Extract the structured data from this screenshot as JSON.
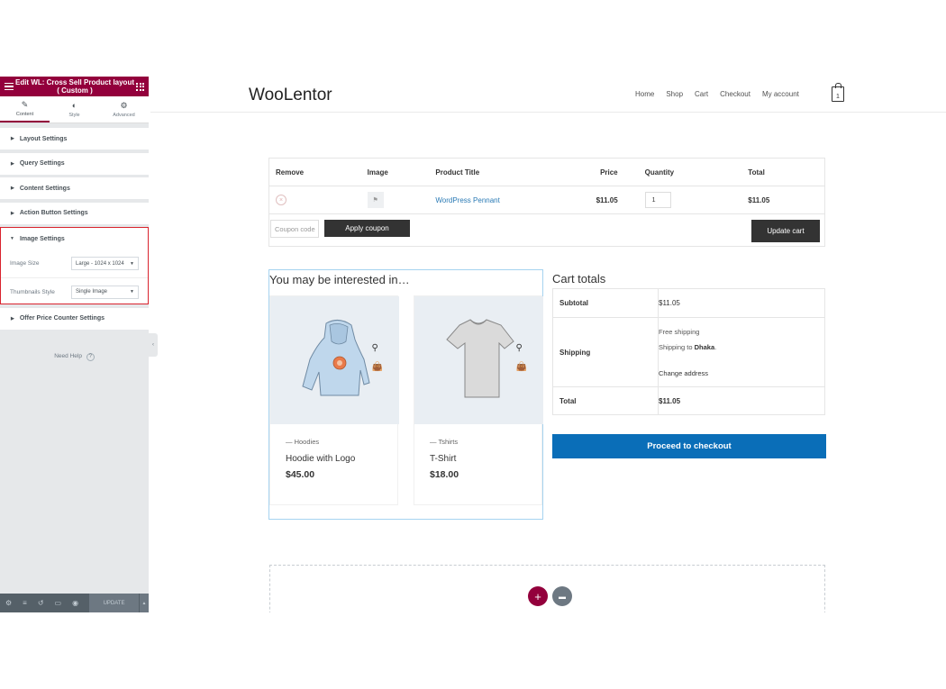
{
  "colors": {
    "accent": "#93003c",
    "highlight": "#d9232d",
    "checkout": "#0a6eb8",
    "button_dark": "#333333"
  },
  "editor": {
    "title": "Edit WL: Cross Sell Product layout ( Custom )",
    "tabs": [
      {
        "label": "Content",
        "icon": "pencil-icon"
      },
      {
        "label": "Style",
        "icon": "contrast-icon"
      },
      {
        "label": "Advanced",
        "icon": "gear-icon"
      }
    ],
    "sections": [
      "Layout Settings",
      "Query Settings",
      "Content Settings",
      "Action Button Settings"
    ],
    "image_settings": {
      "label": "Image Settings",
      "image_size_label": "Image Size",
      "image_size_value": "Large - 1024 x 1024",
      "thumbnails_style_label": "Thumbnails Style",
      "thumbnails_style_value": "Single Image"
    },
    "offer_section": "Offer Price Counter Settings",
    "need_help": "Need Help",
    "update_label": "UPDATE"
  },
  "site": {
    "logo": "WooLentor",
    "nav": [
      "Home",
      "Shop",
      "Cart",
      "Checkout",
      "My account"
    ],
    "cart_count": "1"
  },
  "cart": {
    "headers": [
      "Remove",
      "Image",
      "Product Title",
      "Price",
      "Quantity",
      "Total"
    ],
    "row": {
      "product": "WordPress Pennant",
      "price": "$11.05",
      "quantity": "1",
      "total": "$11.05"
    },
    "coupon_placeholder": "Coupon code",
    "apply_coupon": "Apply coupon",
    "update_cart": "Update cart"
  },
  "cross_sell": {
    "heading": "You may be interested in…",
    "products": [
      {
        "category": "Hoodies",
        "name": "Hoodie with Logo",
        "price": "$45.00"
      },
      {
        "category": "Tshirts",
        "name": "T-Shirt",
        "price": "$18.00"
      }
    ]
  },
  "totals": {
    "heading": "Cart totals",
    "subtotal_label": "Subtotal",
    "subtotal_value": "$11.05",
    "shipping_label": "Shipping",
    "shipping_method": "Free shipping",
    "shipping_to_prefix": "Shipping to ",
    "shipping_to_city": "Dhaka",
    "shipping_to_suffix": ".",
    "change_address": "Change address",
    "total_label": "Total",
    "total_value": "$11.05",
    "checkout_label": "Proceed to checkout"
  }
}
